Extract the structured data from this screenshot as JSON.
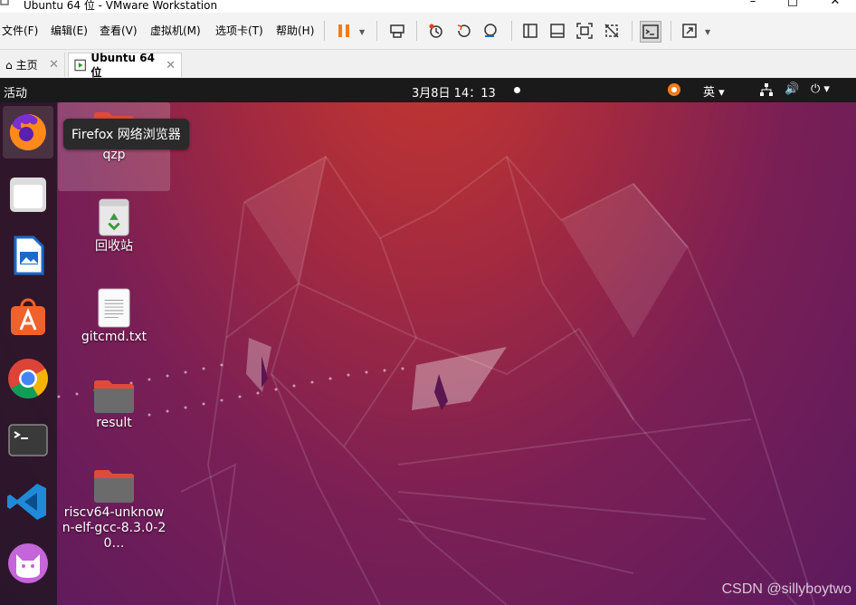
{
  "window": {
    "title": "Ubuntu 64 位 - VMware Workstation"
  },
  "menu": [
    "文件(F)",
    "编辑(E)",
    "查看(V)",
    "虚拟机(M)",
    "选项卡(T)",
    "帮助(H)"
  ],
  "tabs": {
    "home": "主页",
    "vm": "Ubuntu 64 位"
  },
  "topbar": {
    "activities": "活动",
    "clock": "3月8日  14：13",
    "ime": "英"
  },
  "tooltip": "Firefox 网络浏览器",
  "desktop_icons": [
    {
      "label": "qzp"
    },
    {
      "label": "回收站"
    },
    {
      "label": "gitcmd.txt"
    },
    {
      "label": "result"
    },
    {
      "label": "riscv64-unknown-elf-gcc-8.3.0-20…"
    }
  ],
  "watermark": "CSDN @sillyboytwo"
}
